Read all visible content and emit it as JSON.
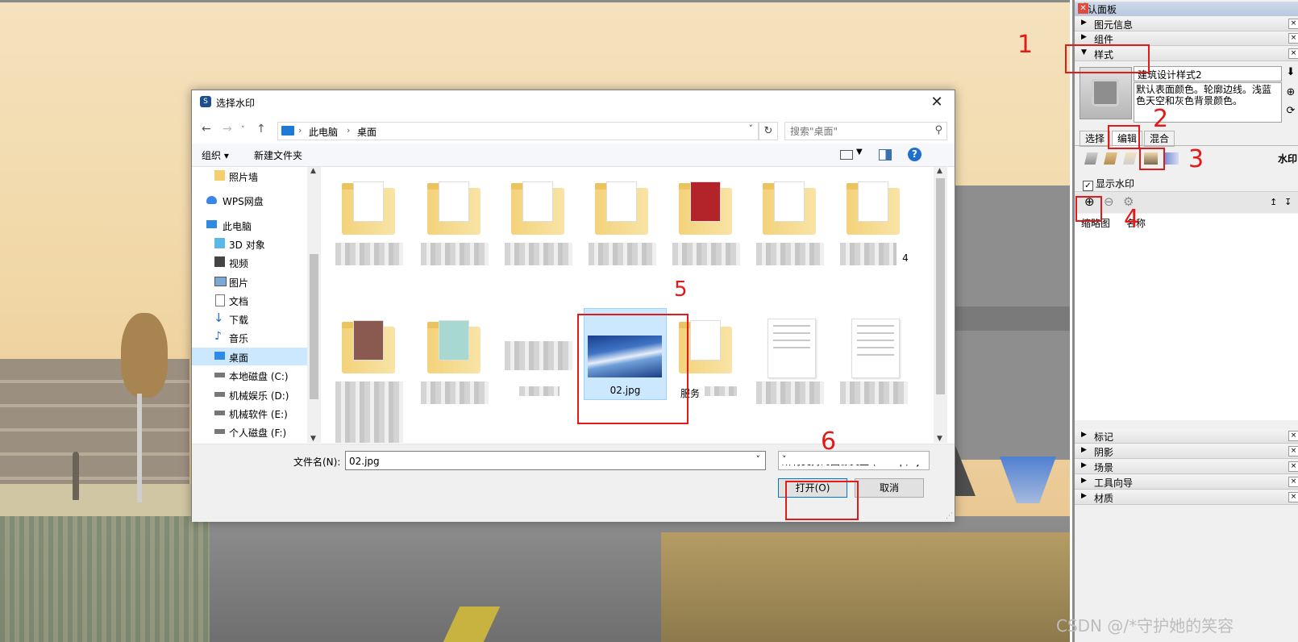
{
  "dialog": {
    "title": "选择水印",
    "path": [
      "此电脑",
      "桌面"
    ],
    "search_placeholder": "搜索\"桌面\"",
    "toolbar": {
      "organize": "组织 ▾",
      "new_folder": "新建文件夹"
    },
    "nav": [
      {
        "label": "照片墙",
        "icon": "folder-icon"
      },
      {
        "label": "WPS网盘",
        "icon": "cloud-icon"
      },
      {
        "label": "此电脑",
        "icon": "computer-icon"
      },
      {
        "label": "3D 对象",
        "icon": "cube-icon"
      },
      {
        "label": "视频",
        "icon": "video-icon"
      },
      {
        "label": "图片",
        "icon": "picture-icon"
      },
      {
        "label": "文档",
        "icon": "document-icon"
      },
      {
        "label": "下载",
        "icon": "download-icon"
      },
      {
        "label": "音乐",
        "icon": "music-icon"
      },
      {
        "label": "桌面",
        "icon": "desktop-icon",
        "selected": true
      },
      {
        "label": "本地磁盘 (C:)",
        "icon": "drive-icon"
      },
      {
        "label": "机械娱乐 (D:)",
        "icon": "drive-icon"
      },
      {
        "label": "机械软件 (E:)",
        "icon": "drive-icon"
      },
      {
        "label": "个人磁盘 (F:)",
        "icon": "drive-icon"
      }
    ],
    "files": {
      "selected_name": "02.jpg",
      "partial_label": "服务",
      "side_label": "4"
    },
    "filename_label": "文件名(N):",
    "filename_value": "02.jpg",
    "filetype": "所有支持的图像类型 (*.bmp;*.j",
    "open_label": "打开(O)",
    "cancel_label": "取消"
  },
  "tray": {
    "title": "默认面板",
    "sections_top": [
      "图元信息",
      "组件",
      "样式"
    ],
    "style_name": "建筑设计样式2",
    "style_desc": "默认表面颜色。轮廓边线。浅蓝色天空和灰色背景颜色。",
    "tabs": [
      "选择",
      "编辑",
      "混合"
    ],
    "watermark_label": "水印",
    "show_watermark": "显示水印",
    "col_thumbnail": "缩略图",
    "col_name": "名称",
    "sections_bottom": [
      "标记",
      "阴影",
      "场景",
      "工具向导",
      "材质"
    ]
  },
  "annotations": [
    "1",
    "2",
    "3",
    "4",
    "5",
    "6"
  ],
  "watermark_text": "CSDN @/*守护她的笑容"
}
